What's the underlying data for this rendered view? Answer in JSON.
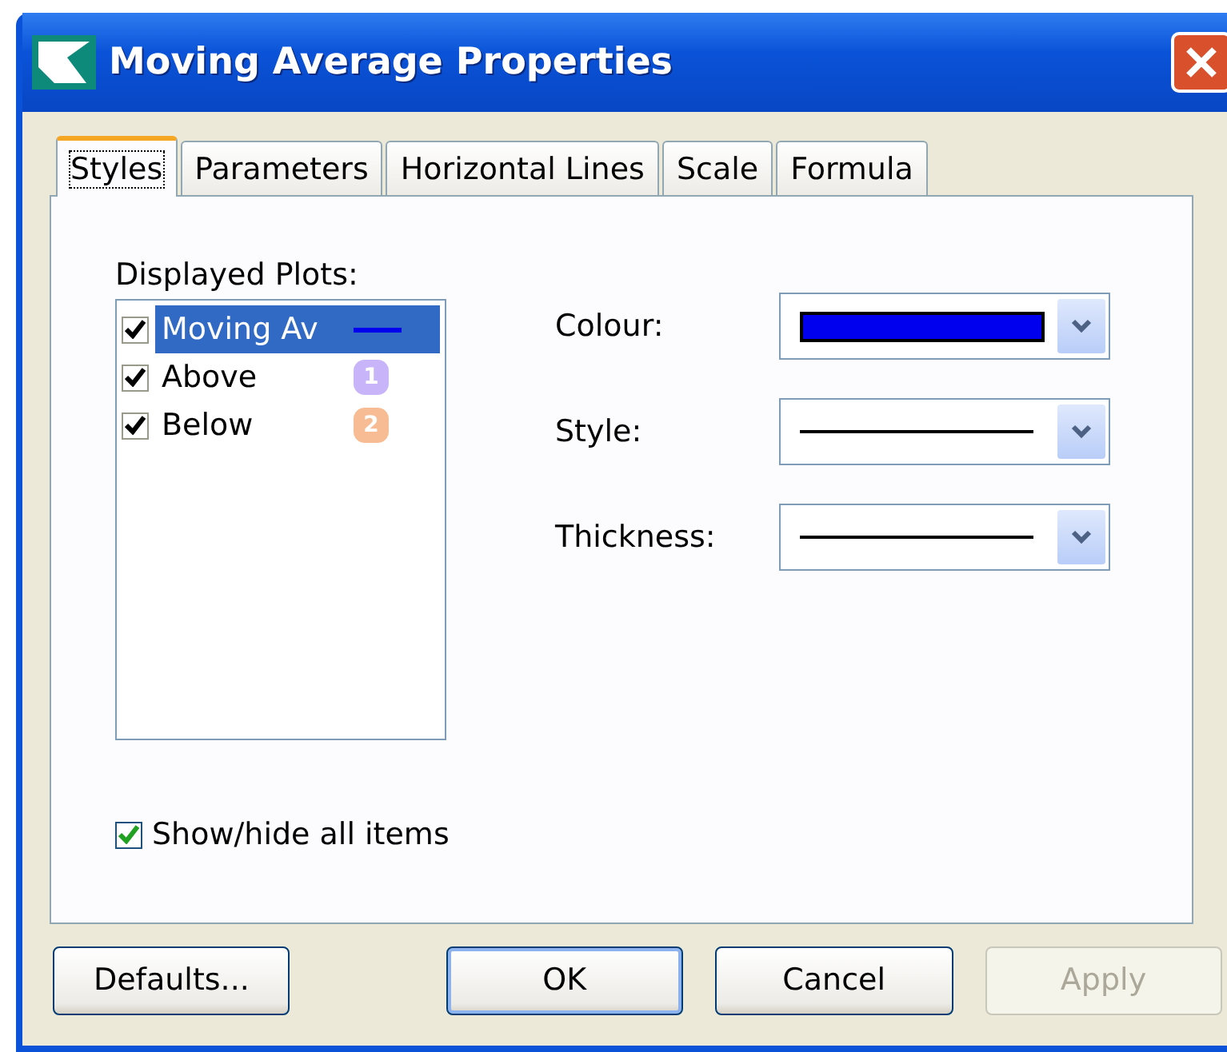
{
  "window": {
    "title": "Moving Average Properties"
  },
  "tabs": [
    {
      "label": "Styles",
      "selected": true
    },
    {
      "label": "Parameters",
      "selected": false
    },
    {
      "label": "Horizontal Lines",
      "selected": false
    },
    {
      "label": "Scale",
      "selected": false
    },
    {
      "label": "Formula",
      "selected": false
    }
  ],
  "plots": {
    "label": "Displayed Plots:",
    "items": [
      {
        "name": "Moving Av",
        "checked": true,
        "selected": true,
        "kind": "line",
        "color": "#0000ee"
      },
      {
        "name": "Above",
        "checked": true,
        "selected": false,
        "kind": "badge",
        "badge": "1",
        "color": "#c8b4f8"
      },
      {
        "name": "Below",
        "checked": true,
        "selected": false,
        "kind": "badge",
        "badge": "2",
        "color": "#f8bc94"
      }
    ]
  },
  "fields": [
    {
      "label": "Colour:",
      "kind": "color",
      "color": "#0000ee"
    },
    {
      "label": "Style:",
      "kind": "line"
    },
    {
      "label": "Thickness:",
      "kind": "line"
    }
  ],
  "show_all": {
    "label": "Show/hide all items",
    "checked": true
  },
  "buttons": [
    {
      "label": "Defaults...",
      "disabled": false,
      "default": false
    },
    {
      "label": "OK",
      "disabled": false,
      "default": true
    },
    {
      "label": "Cancel",
      "disabled": false,
      "default": false
    },
    {
      "label": "Apply",
      "disabled": true,
      "default": false
    }
  ]
}
